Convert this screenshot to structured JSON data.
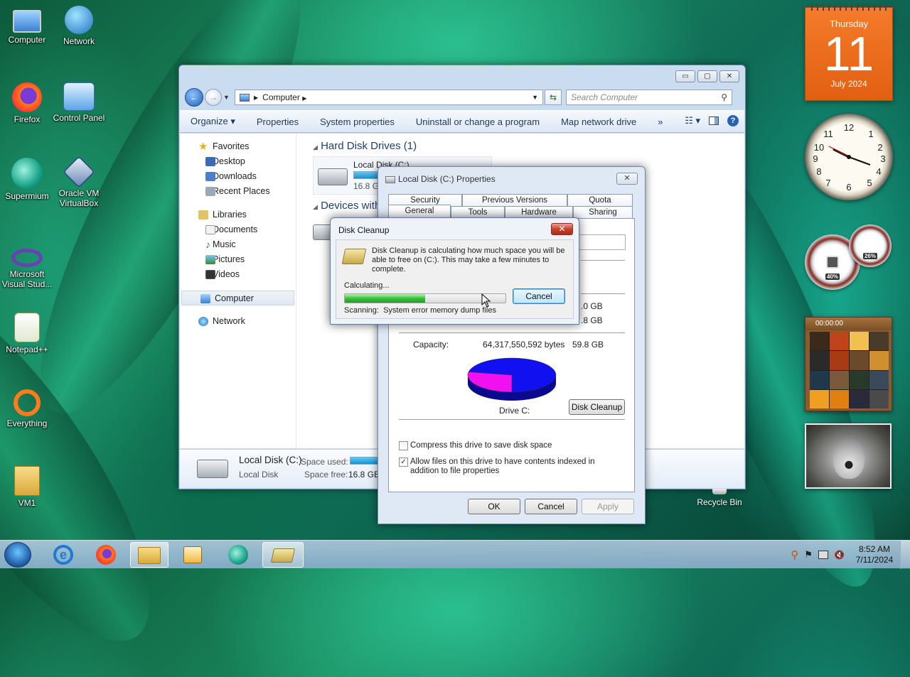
{
  "desktop": {
    "icons": [
      {
        "label": "Computer",
        "icon": "computer-icon"
      },
      {
        "label": "Network",
        "icon": "network-icon"
      },
      {
        "label": "Firefox",
        "icon": "firefox-icon"
      },
      {
        "label": "Control Panel",
        "icon": "control-panel-icon"
      },
      {
        "label": "Supermium",
        "icon": "supermium-icon"
      },
      {
        "label": "Oracle VM VirtualBox",
        "icon": "virtualbox-icon"
      },
      {
        "label": "Microsoft Visual Stud...",
        "icon": "visual-studio-icon"
      },
      {
        "label": "Notepad++",
        "icon": "notepadpp-icon"
      },
      {
        "label": "Everything",
        "icon": "everything-icon"
      },
      {
        "label": "VM1",
        "icon": "folder-icon"
      }
    ],
    "recycle_bin": "Recycle Bin"
  },
  "explorer": {
    "address": "Computer",
    "search_placeholder": "Search Computer",
    "toolbar": [
      "Organize",
      "Properties",
      "System properties",
      "Uninstall or change a program",
      "Map network drive",
      "»"
    ],
    "nav": {
      "favorites": "Favorites",
      "favorites_items": [
        "Desktop",
        "Downloads",
        "Recent Places"
      ],
      "libraries": "Libraries",
      "libraries_items": [
        "Documents",
        "Music",
        "Pictures",
        "Videos"
      ],
      "computer": "Computer",
      "network": "Network"
    },
    "groups": {
      "hdd": "Hard Disk Drives (1)",
      "devices": "Devices with R"
    },
    "drive": {
      "name": "Local Disk (C:)",
      "free": "16.8 GB",
      "used_fraction": 0.72
    },
    "details": {
      "name": "Local Disk (C:)",
      "type": "Local Disk",
      "space_used_label": "Space used:",
      "space_free_label": "Space free:",
      "space_free": "16.8 GB"
    }
  },
  "properties": {
    "title": "Local Disk (C:) Properties",
    "tabs_back": [
      "Security",
      "Previous Versions",
      "Quota"
    ],
    "tabs_front": [
      "General",
      "Tools",
      "Hardware",
      "Sharing"
    ],
    "used_tail": ".0 GB",
    "free_tail": ".8 GB",
    "capacity_label": "Capacity:",
    "capacity_bytes": "64,317,550,592 bytes",
    "capacity_gb": "59.8 GB",
    "drive_label": "Drive C:",
    "disk_cleanup_button": "Disk Cleanup",
    "compress_label": "Compress this drive to save disk space",
    "index_label": "Allow files on this drive to have contents indexed in addition to file properties",
    "ok": "OK",
    "cancel": "Cancel",
    "apply": "Apply",
    "pie": {
      "used_fraction": 0.72
    }
  },
  "disk_cleanup": {
    "title": "Disk Cleanup",
    "message": "Disk Cleanup is calculating how much space you will be able to free on  (C:). This may take a few minutes to complete.",
    "status": "Calculating...",
    "cancel": "Cancel",
    "scanning_label": "Scanning:",
    "scanning_item": "System error memory dump files",
    "progress_fraction": 0.5
  },
  "gadgets": {
    "calendar": {
      "weekday": "Thursday",
      "day": "11",
      "month_year": "July 2024"
    },
    "cpu": "40%",
    "mem": "26%",
    "puzzle_timer": "00:00:00"
  },
  "taskbar": {
    "time": "8:52 AM",
    "date": "7/11/2024"
  },
  "colors": {
    "used": "#1010f0",
    "free": "#f010f0"
  }
}
